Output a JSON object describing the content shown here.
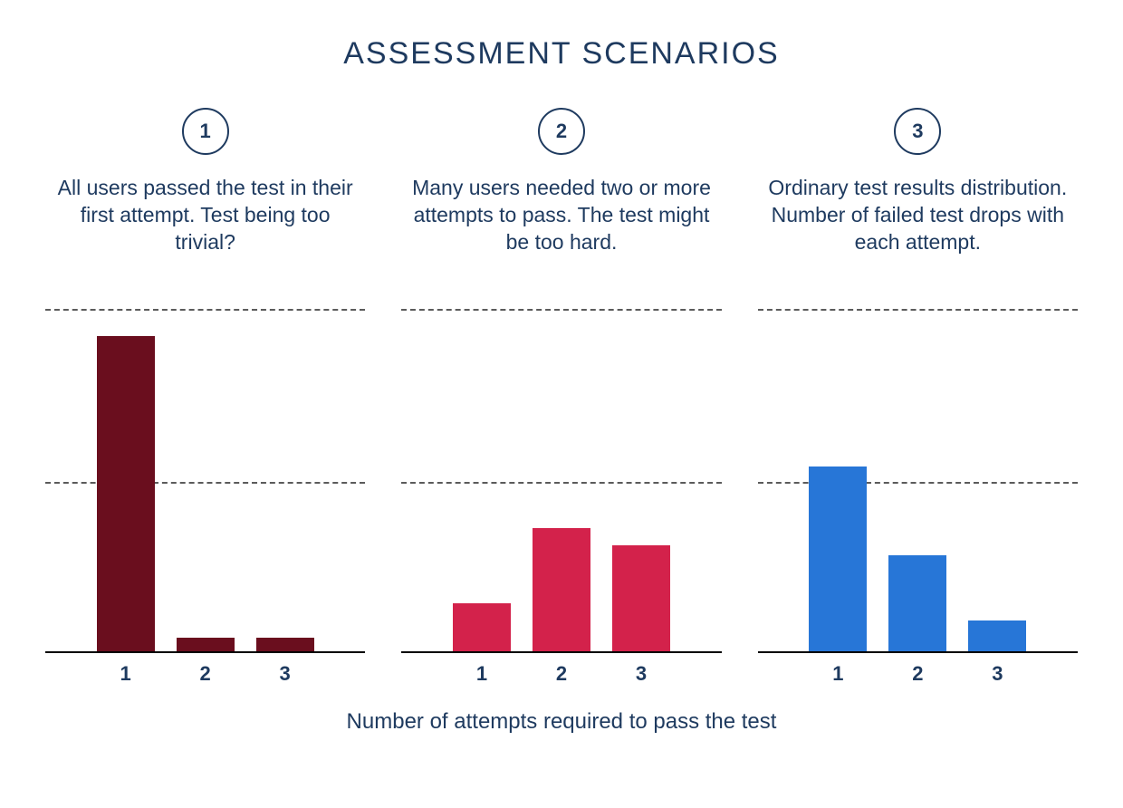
{
  "title": "ASSESSMENT SCENARIOS",
  "axis_label": "Number of attempts required to pass the test",
  "chart_data": [
    {
      "type": "bar",
      "badge": "1",
      "description": "All users passed the test in their first attempt. Test being too trivial?",
      "categories": [
        "1",
        "2",
        "3"
      ],
      "values": [
        92,
        4,
        4
      ],
      "color": "#6a0e1e",
      "xlabel": "",
      "ylabel": "",
      "ylim": [
        0,
        100
      ]
    },
    {
      "type": "bar",
      "badge": "2",
      "description": "Many users needed two or more attempts to pass. The test might be too hard.",
      "categories": [
        "1",
        "2",
        "3"
      ],
      "values": [
        14,
        36,
        31
      ],
      "color": "#d3224b",
      "xlabel": "",
      "ylabel": "",
      "ylim": [
        0,
        100
      ]
    },
    {
      "type": "bar",
      "badge": "3",
      "description": "Ordinary test results distribution. Number of failed test drops with each attempt.",
      "categories": [
        "1",
        "2",
        "3"
      ],
      "values": [
        54,
        28,
        9
      ],
      "color": "#2776d7",
      "xlabel": "",
      "ylabel": "",
      "ylim": [
        0,
        100
      ]
    }
  ]
}
